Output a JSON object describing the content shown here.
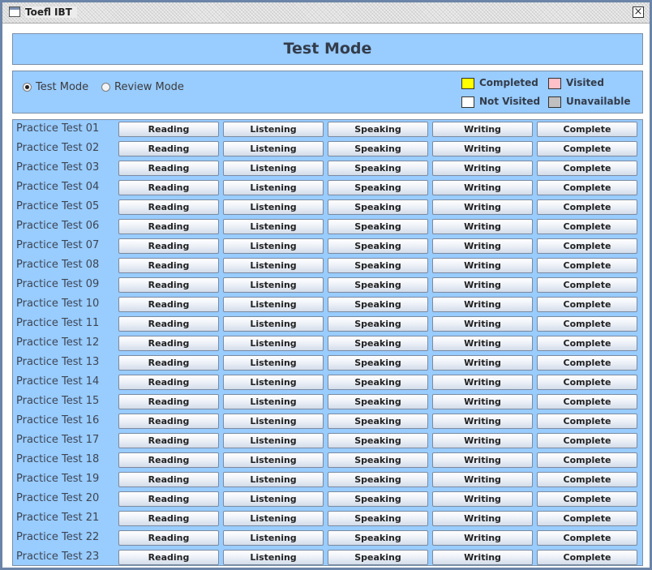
{
  "window": {
    "title": "Toefl IBT",
    "close_label": "×"
  },
  "header": {
    "title": "Test Mode"
  },
  "modes": [
    {
      "label": "Test Mode",
      "checked": true
    },
    {
      "label": "Review Mode",
      "checked": false
    }
  ],
  "legend": [
    {
      "label": "Completed",
      "color": "#ffff00"
    },
    {
      "label": "Visited",
      "color": "#ffc0c8"
    },
    {
      "label": "Not Visited",
      "color": "#ffffff"
    },
    {
      "label": "Unavailable",
      "color": "#c0c0c0"
    }
  ],
  "sections": [
    "Reading",
    "Listening",
    "Speaking",
    "Writing",
    "Complete"
  ],
  "tests": [
    "Practice Test 01",
    "Practice Test 02",
    "Practice Test 03",
    "Practice Test 04",
    "Practice Test 05",
    "Practice Test 06",
    "Practice Test 07",
    "Practice Test 08",
    "Practice Test 09",
    "Practice Test 10",
    "Practice Test 11",
    "Practice Test 12",
    "Practice Test 13",
    "Practice Test 14",
    "Practice Test 15",
    "Practice Test 16",
    "Practice Test 17",
    "Practice Test 18",
    "Practice Test 19",
    "Practice Test 20",
    "Practice Test 21",
    "Practice Test 22",
    "Practice Test 23"
  ]
}
